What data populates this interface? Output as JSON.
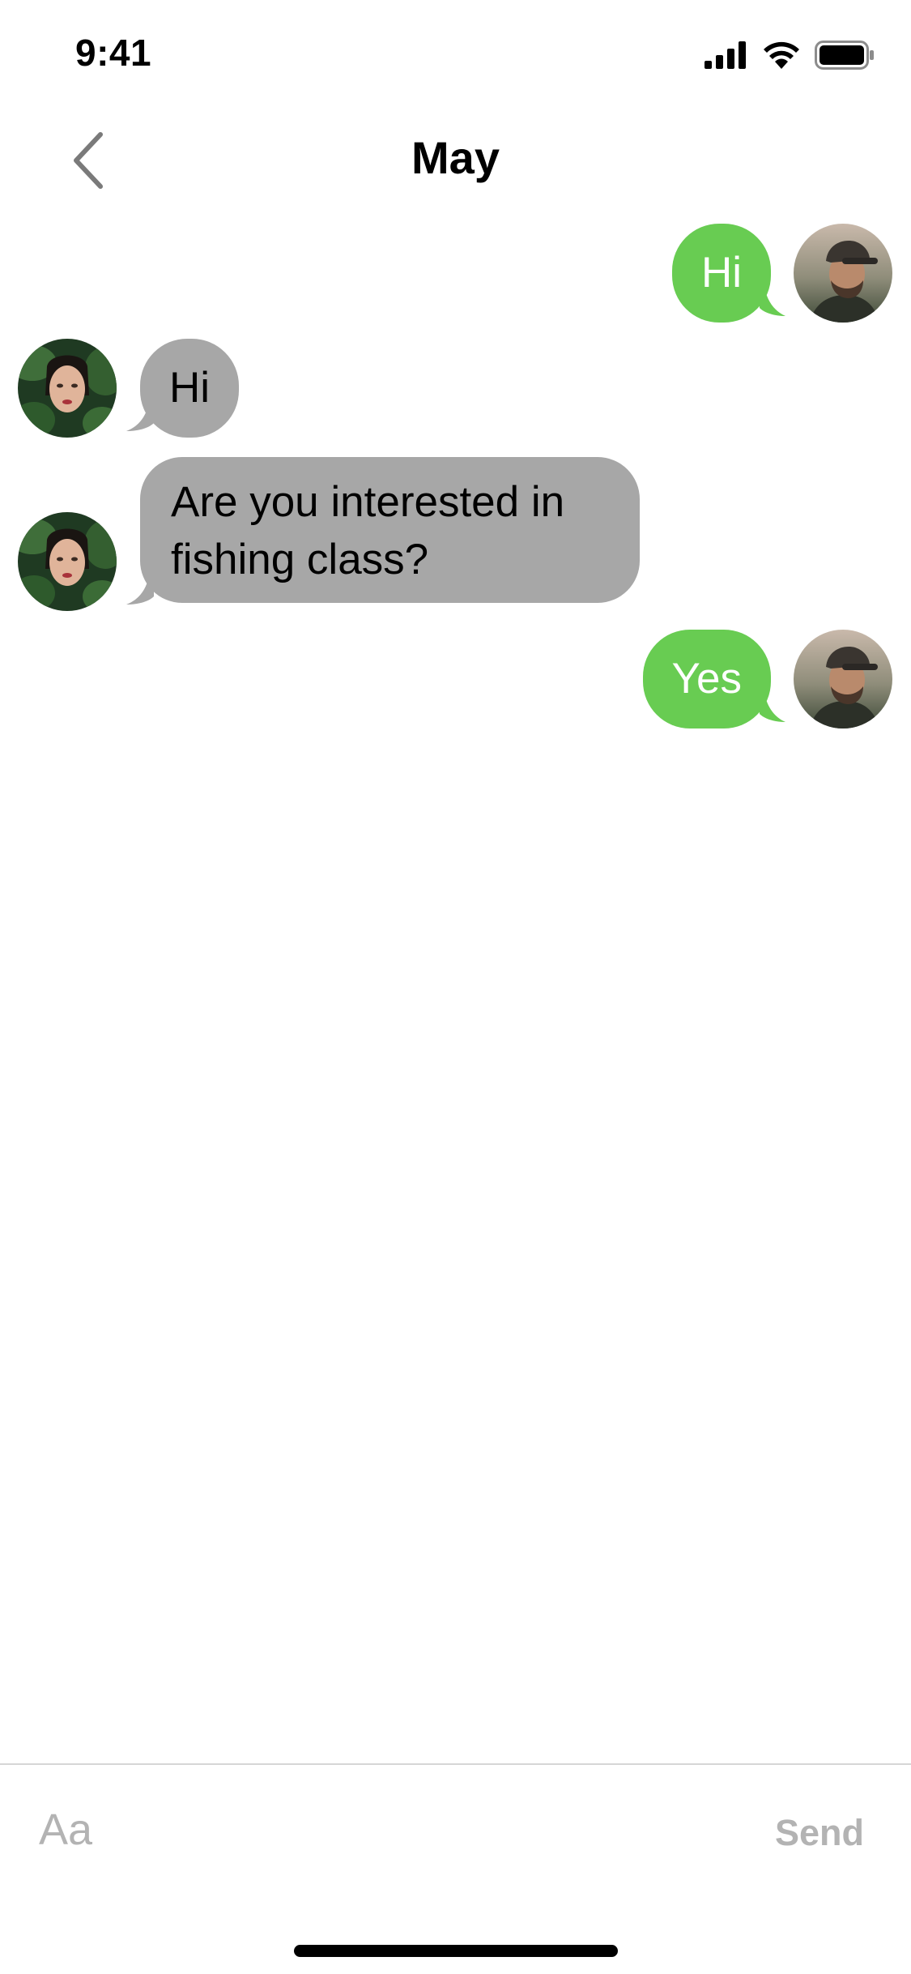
{
  "status_bar": {
    "time": "9:41",
    "icons": [
      "cellular-signal-icon",
      "wifi-icon",
      "battery-icon"
    ]
  },
  "header": {
    "title": "May",
    "back_icon": "chevron-left-icon"
  },
  "messages": [
    {
      "direction": "outgoing",
      "text": "Hi"
    },
    {
      "direction": "incoming",
      "text": "Hi"
    },
    {
      "direction": "incoming",
      "text": "Are you interested in fishing class?"
    },
    {
      "direction": "outgoing",
      "text": "Yes"
    }
  ],
  "composer": {
    "placeholder": "Aa",
    "value": "",
    "send_label": "Send"
  },
  "colors": {
    "outgoing_bubble": "#68cc52",
    "incoming_bubble": "#a7a7a7",
    "muted_text": "#b3b3b3"
  }
}
